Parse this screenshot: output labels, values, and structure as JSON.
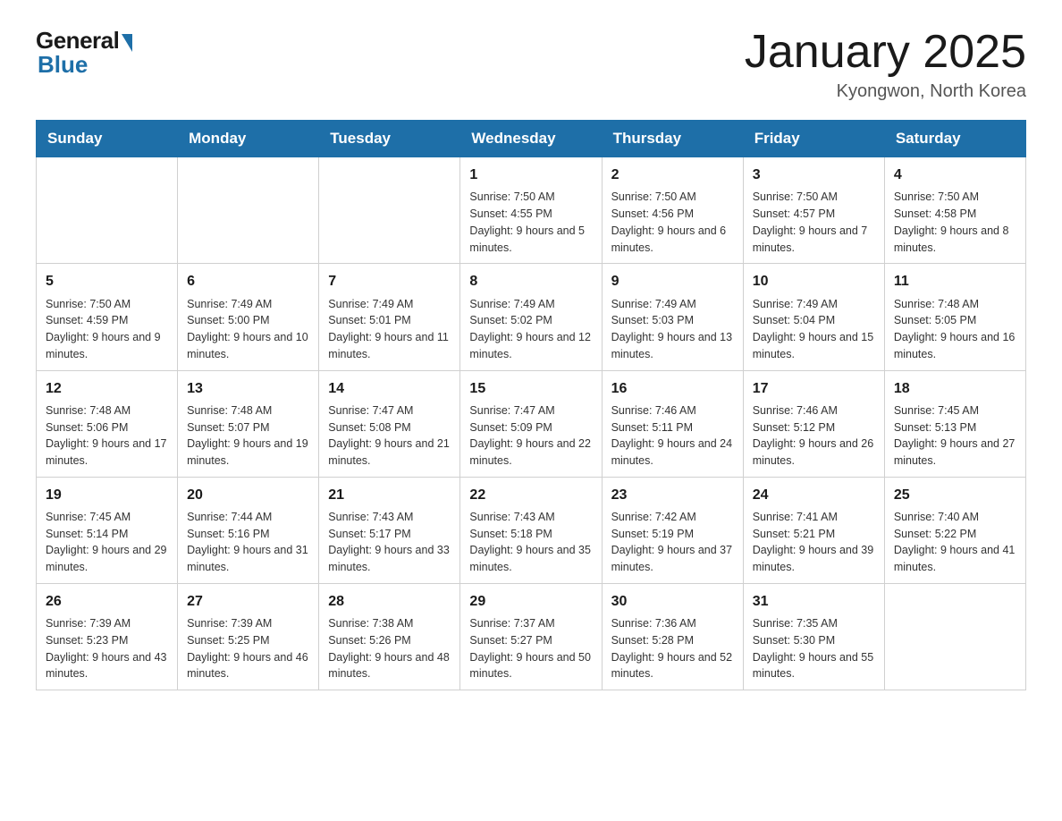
{
  "header": {
    "logo_general": "General",
    "logo_blue": "Blue",
    "month_title": "January 2025",
    "location": "Kyongwon, North Korea"
  },
  "days_of_week": [
    "Sunday",
    "Monday",
    "Tuesday",
    "Wednesday",
    "Thursday",
    "Friday",
    "Saturday"
  ],
  "weeks": [
    [
      {
        "day": "",
        "info": ""
      },
      {
        "day": "",
        "info": ""
      },
      {
        "day": "",
        "info": ""
      },
      {
        "day": "1",
        "info": "Sunrise: 7:50 AM\nSunset: 4:55 PM\nDaylight: 9 hours and 5 minutes."
      },
      {
        "day": "2",
        "info": "Sunrise: 7:50 AM\nSunset: 4:56 PM\nDaylight: 9 hours and 6 minutes."
      },
      {
        "day": "3",
        "info": "Sunrise: 7:50 AM\nSunset: 4:57 PM\nDaylight: 9 hours and 7 minutes."
      },
      {
        "day": "4",
        "info": "Sunrise: 7:50 AM\nSunset: 4:58 PM\nDaylight: 9 hours and 8 minutes."
      }
    ],
    [
      {
        "day": "5",
        "info": "Sunrise: 7:50 AM\nSunset: 4:59 PM\nDaylight: 9 hours and 9 minutes."
      },
      {
        "day": "6",
        "info": "Sunrise: 7:49 AM\nSunset: 5:00 PM\nDaylight: 9 hours and 10 minutes."
      },
      {
        "day": "7",
        "info": "Sunrise: 7:49 AM\nSunset: 5:01 PM\nDaylight: 9 hours and 11 minutes."
      },
      {
        "day": "8",
        "info": "Sunrise: 7:49 AM\nSunset: 5:02 PM\nDaylight: 9 hours and 12 minutes."
      },
      {
        "day": "9",
        "info": "Sunrise: 7:49 AM\nSunset: 5:03 PM\nDaylight: 9 hours and 13 minutes."
      },
      {
        "day": "10",
        "info": "Sunrise: 7:49 AM\nSunset: 5:04 PM\nDaylight: 9 hours and 15 minutes."
      },
      {
        "day": "11",
        "info": "Sunrise: 7:48 AM\nSunset: 5:05 PM\nDaylight: 9 hours and 16 minutes."
      }
    ],
    [
      {
        "day": "12",
        "info": "Sunrise: 7:48 AM\nSunset: 5:06 PM\nDaylight: 9 hours and 17 minutes."
      },
      {
        "day": "13",
        "info": "Sunrise: 7:48 AM\nSunset: 5:07 PM\nDaylight: 9 hours and 19 minutes."
      },
      {
        "day": "14",
        "info": "Sunrise: 7:47 AM\nSunset: 5:08 PM\nDaylight: 9 hours and 21 minutes."
      },
      {
        "day": "15",
        "info": "Sunrise: 7:47 AM\nSunset: 5:09 PM\nDaylight: 9 hours and 22 minutes."
      },
      {
        "day": "16",
        "info": "Sunrise: 7:46 AM\nSunset: 5:11 PM\nDaylight: 9 hours and 24 minutes."
      },
      {
        "day": "17",
        "info": "Sunrise: 7:46 AM\nSunset: 5:12 PM\nDaylight: 9 hours and 26 minutes."
      },
      {
        "day": "18",
        "info": "Sunrise: 7:45 AM\nSunset: 5:13 PM\nDaylight: 9 hours and 27 minutes."
      }
    ],
    [
      {
        "day": "19",
        "info": "Sunrise: 7:45 AM\nSunset: 5:14 PM\nDaylight: 9 hours and 29 minutes."
      },
      {
        "day": "20",
        "info": "Sunrise: 7:44 AM\nSunset: 5:16 PM\nDaylight: 9 hours and 31 minutes."
      },
      {
        "day": "21",
        "info": "Sunrise: 7:43 AM\nSunset: 5:17 PM\nDaylight: 9 hours and 33 minutes."
      },
      {
        "day": "22",
        "info": "Sunrise: 7:43 AM\nSunset: 5:18 PM\nDaylight: 9 hours and 35 minutes."
      },
      {
        "day": "23",
        "info": "Sunrise: 7:42 AM\nSunset: 5:19 PM\nDaylight: 9 hours and 37 minutes."
      },
      {
        "day": "24",
        "info": "Sunrise: 7:41 AM\nSunset: 5:21 PM\nDaylight: 9 hours and 39 minutes."
      },
      {
        "day": "25",
        "info": "Sunrise: 7:40 AM\nSunset: 5:22 PM\nDaylight: 9 hours and 41 minutes."
      }
    ],
    [
      {
        "day": "26",
        "info": "Sunrise: 7:39 AM\nSunset: 5:23 PM\nDaylight: 9 hours and 43 minutes."
      },
      {
        "day": "27",
        "info": "Sunrise: 7:39 AM\nSunset: 5:25 PM\nDaylight: 9 hours and 46 minutes."
      },
      {
        "day": "28",
        "info": "Sunrise: 7:38 AM\nSunset: 5:26 PM\nDaylight: 9 hours and 48 minutes."
      },
      {
        "day": "29",
        "info": "Sunrise: 7:37 AM\nSunset: 5:27 PM\nDaylight: 9 hours and 50 minutes."
      },
      {
        "day": "30",
        "info": "Sunrise: 7:36 AM\nSunset: 5:28 PM\nDaylight: 9 hours and 52 minutes."
      },
      {
        "day": "31",
        "info": "Sunrise: 7:35 AM\nSunset: 5:30 PM\nDaylight: 9 hours and 55 minutes."
      },
      {
        "day": "",
        "info": ""
      }
    ]
  ]
}
